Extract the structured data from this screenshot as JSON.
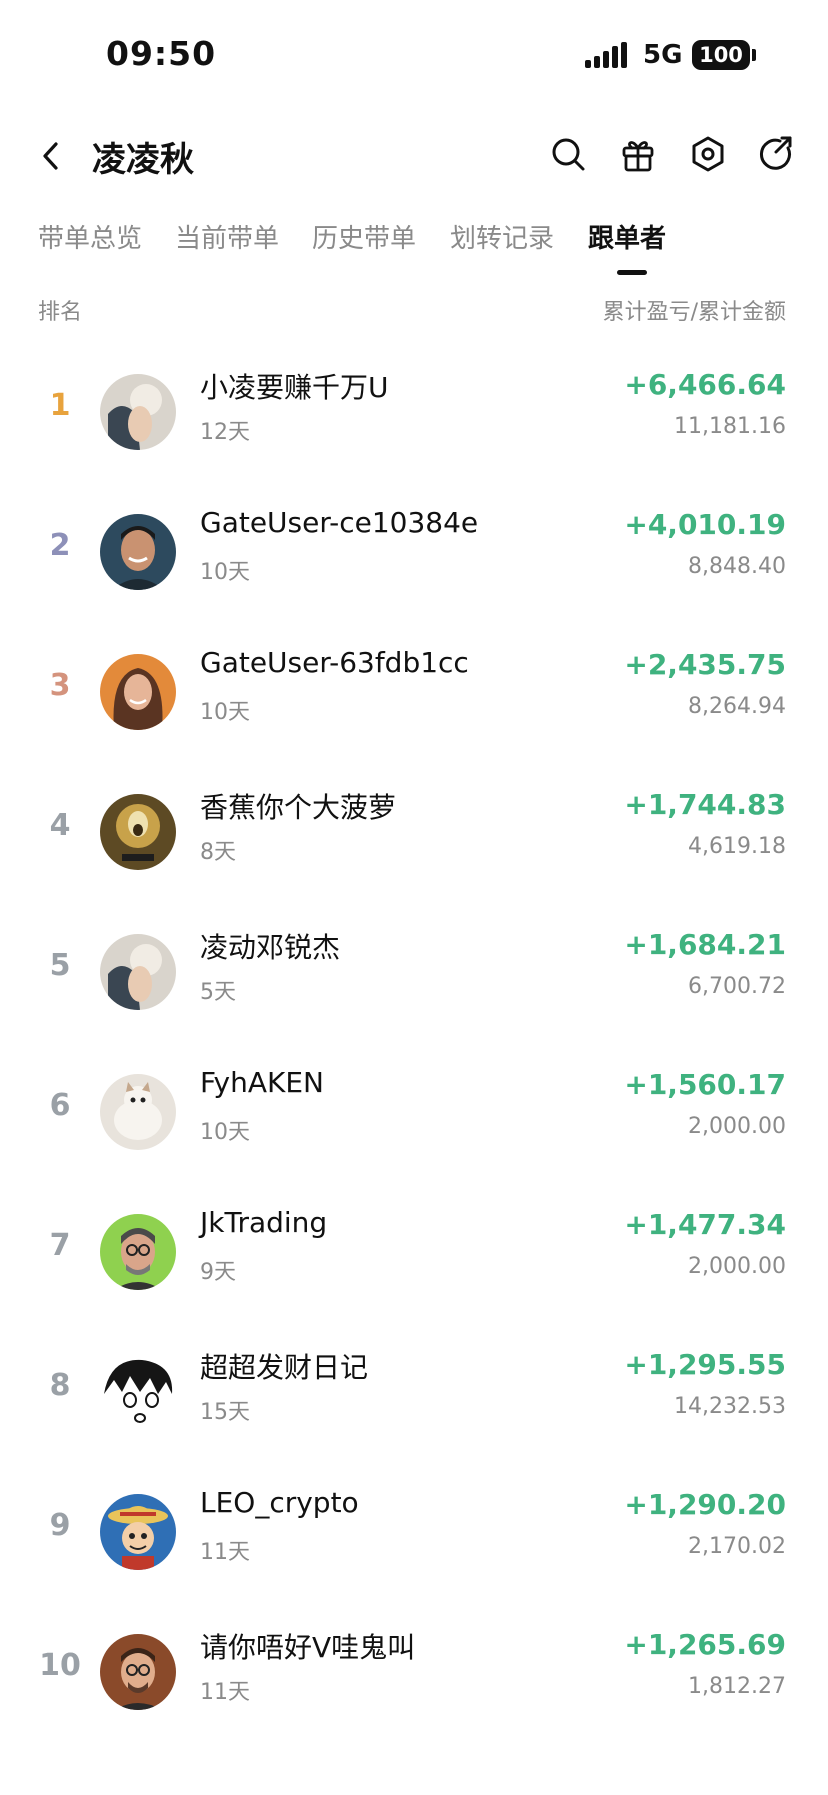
{
  "status_bar": {
    "time": "09:50",
    "network": "5G",
    "battery": "100"
  },
  "header": {
    "title": "凌凌秋"
  },
  "tabs": [
    {
      "label": "带单总览"
    },
    {
      "label": "当前带单"
    },
    {
      "label": "历史带单"
    },
    {
      "label": "划转记录"
    },
    {
      "label": "跟单者"
    }
  ],
  "active_tab": "跟单者",
  "list_header": {
    "left": "排名",
    "right": "累计盈亏/累计金额"
  },
  "colors": {
    "positive": "#3fb27f",
    "rank_gold": "#e8a33d",
    "rank_silver": "#8d90b8",
    "rank_bronze": "#d4937d",
    "rank_default": "#9aa0a6"
  },
  "followers": [
    {
      "rank": "1",
      "name": "小凌要赚千万U",
      "days": "12天",
      "pnl": "+6,466.64",
      "amount": "11,181.16"
    },
    {
      "rank": "2",
      "name": "GateUser-ce10384e",
      "days": "10天",
      "pnl": "+4,010.19",
      "amount": "8,848.40"
    },
    {
      "rank": "3",
      "name": "GateUser-63fdb1cc",
      "days": "10天",
      "pnl": "+2,435.75",
      "amount": "8,264.94"
    },
    {
      "rank": "4",
      "name": "香蕉你个大菠萝",
      "days": "8天",
      "pnl": "+1,744.83",
      "amount": "4,619.18"
    },
    {
      "rank": "5",
      "name": "凌动邓锐杰",
      "days": "5天",
      "pnl": "+1,684.21",
      "amount": "6,700.72"
    },
    {
      "rank": "6",
      "name": "FyhAKEN",
      "days": "10天",
      "pnl": "+1,560.17",
      "amount": "2,000.00"
    },
    {
      "rank": "7",
      "name": "JkTrading",
      "days": "9天",
      "pnl": "+1,477.34",
      "amount": "2,000.00"
    },
    {
      "rank": "8",
      "name": "超超发财日记",
      "days": "15天",
      "pnl": "+1,295.55",
      "amount": "14,232.53"
    },
    {
      "rank": "9",
      "name": "LEO_crypto",
      "days": "11天",
      "pnl": "+1,290.20",
      "amount": "2,170.02"
    },
    {
      "rank": "10",
      "name": "请你唔好V哇鬼叫",
      "days": "11天",
      "pnl": "+1,265.69",
      "amount": "1,812.27"
    }
  ]
}
